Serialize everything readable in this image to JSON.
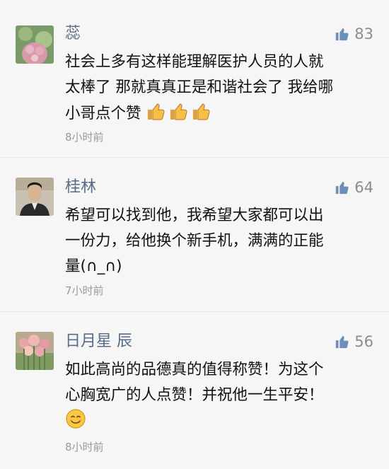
{
  "comments": [
    {
      "name": "蕊",
      "likes": "83",
      "lines": [
        "社会上多有这样能理解医护人员的人就",
        "太棒了 那就真真正是和谐社会了 我给哪",
        "小哥点个赞"
      ],
      "emoji": [
        "thumbs-up-emoji",
        "thumbs-up-emoji",
        "thumbs-up-emoji"
      ],
      "time": "8小时前"
    },
    {
      "name": "桂林",
      "likes": "64",
      "lines": [
        "希望可以找到他，我希望大家都可以出",
        "一份力，给他换个新手机，满满的正能",
        "量(∩_∩)"
      ],
      "time": "7小时前"
    },
    {
      "name": "日月星 辰",
      "likes": "56",
      "lines": [
        "如此高尚的品德真的值得称赞！为这个",
        "心胸宽广的人点赞！并祝他一生平安！"
      ],
      "emoji": [
        "smiling-face-emoji"
      ],
      "time": "8小时前"
    }
  ],
  "colors": {
    "name": "#586b86",
    "like_icon": "#6b8fb8",
    "time": "#9a9a9a"
  }
}
